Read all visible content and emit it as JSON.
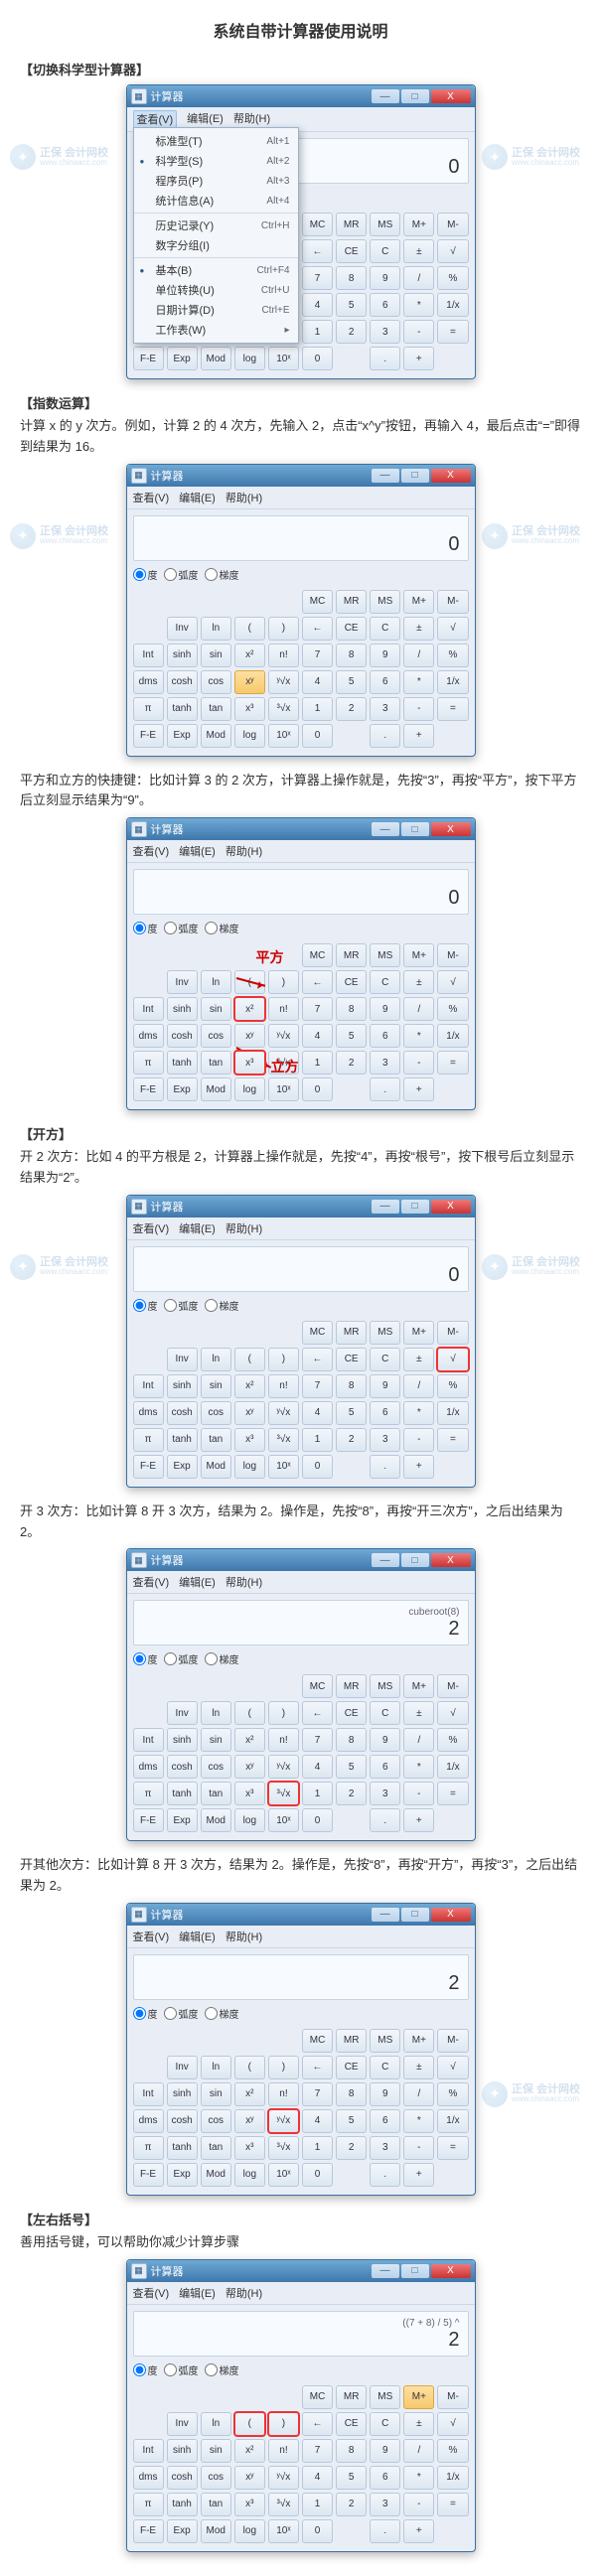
{
  "doc": {
    "title": "系统自带计算器使用说明",
    "s1_head": "【切换科学型计算器】",
    "s2_head": "【指数运算】",
    "s2_para": "计算 x 的 y 次方。例如，计算 2 的 4 次方，先输入 2，点击“x^y”按钮，再输入 4，最后点击“=”即得到结果为 16。",
    "s2b_para1": "平方和立方的快捷键：比如计算 3 的 2 次方，计算器上操作就是，先按“3”，再按“平方”，按下平方后立刻显示结果为“9”。",
    "s3_head": "【开方】",
    "s3_para": "开 2 次方：比如 4 的平方根是 2，计算器上操作就是，先按“4”，再按“根号”，按下根号后立刻显示结果为“2”。",
    "s3b_para": "开 3 次方：比如计算 8 开 3 次方，结果为 2。操作是，先按“8”，再按“开三次方”，之后出结果为 2。",
    "s3c_para": "开其他次方：比如计算 8 开 3 次方，结果为 2。操作是，先按“8”，再按“开方”，再按“3”，之后出结果为 2。",
    "s4_head": "【左右括号】",
    "s4_para": "善用括号键，可以帮助你减少计算步骤"
  },
  "calc": {
    "title": "计算器",
    "menu_view": "查看(V)",
    "menu_edit": "编辑(E)",
    "menu_help": "帮助(H)",
    "minus": "—",
    "square": "□",
    "close": "X",
    "deg": "度",
    "rad": "弧度",
    "grad": "梯度",
    "expr_cuberoot": "cuberoot(8)",
    "expr_paren": "((7 + 8) / 5) ^",
    "val_0": "0",
    "val_2": "2",
    "keys": {
      "r0": [
        "",
        "Inv",
        "ln",
        "(",
        ")",
        "←",
        "CE",
        "C",
        "±",
        "√"
      ],
      "r1": [
        "Int",
        "sinh",
        "sin",
        "x²",
        "n!",
        "7",
        "8",
        "9",
        "/",
        "%"
      ],
      "r2": [
        "dms",
        "cosh",
        "cos",
        "xʸ",
        "ʸ√x",
        "4",
        "5",
        "6",
        "*",
        "1/x"
      ],
      "r3": [
        "π",
        "tanh",
        "tan",
        "x³",
        "³√x",
        "1",
        "2",
        "3",
        "-",
        "="
      ],
      "r4": [
        "F-E",
        "Exp",
        "Mod",
        "log",
        "10ˣ",
        "0",
        "",
        ".",
        "+",
        ""
      ],
      "mem": [
        "",
        "",
        "",
        "",
        "",
        "MC",
        "MR",
        "MS",
        "M+",
        "M-"
      ]
    },
    "menuitems": {
      "std": {
        "l": "标准型(T)",
        "s": "Alt+1"
      },
      "sci": {
        "l": "科学型(S)",
        "s": "Alt+2"
      },
      "prog": {
        "l": "程序员(P)",
        "s": "Alt+3"
      },
      "stat": {
        "l": "统计信息(A)",
        "s": "Alt+4"
      },
      "hist": {
        "l": "历史记录(Y)",
        "s": "Ctrl+H"
      },
      "group": {
        "l": "数字分组(I)",
        "s": ""
      },
      "basic": {
        "l": "基本(B)",
        "s": "Ctrl+F4"
      },
      "unit": {
        "l": "单位转换(U)",
        "s": "Ctrl+U"
      },
      "date": {
        "l": "日期计算(D)",
        "s": "Ctrl+E"
      },
      "sheet": {
        "l": "工作表(W)",
        "s": ""
      }
    },
    "annot_square": "平方",
    "annot_cube": "立方"
  },
  "wm": {
    "cn": "正保 会计网校",
    "en": "www.chinaacc.com",
    "glyph": "✦"
  }
}
